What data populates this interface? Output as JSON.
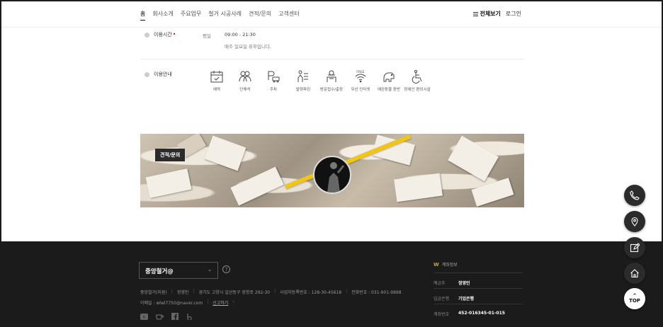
{
  "nav": {
    "items": [
      "홈",
      "회사소개",
      "주요업무",
      "철거 시공사례",
      "견적/문의",
      "고객센터"
    ],
    "all_label": "전체보기",
    "login_label": "로그인"
  },
  "hours": {
    "label": "이용시간",
    "required_mark": "•",
    "day": "평일",
    "time": "09:00 - 21:30",
    "note": "매주 일요일 휴무입니다."
  },
  "amenities": {
    "label": "이용안내",
    "items": [
      {
        "label": "예약",
        "icon": "calendar-icon"
      },
      {
        "label": "단체석",
        "icon": "group-icon"
      },
      {
        "label": "주차",
        "icon": "parking-icon"
      },
      {
        "label": "발렛파킹",
        "icon": "valet-icon"
      },
      {
        "label": "방문접수/출장",
        "icon": "visit-icon"
      },
      {
        "label": "무선 인터넷",
        "icon": "wifi-icon",
        "icon_text": "FREE"
      },
      {
        "label": "애완동물 동반",
        "icon": "pet-icon"
      },
      {
        "label": "장애인 편의시설",
        "icon": "wheelchair-icon"
      }
    ]
  },
  "banner": {
    "badge": "견적/문의"
  },
  "fabs": {
    "phone": "phone-icon",
    "location": "map-pin-icon",
    "write": "edit-icon",
    "home": "home-icon",
    "top_label": "TOP"
  },
  "footer": {
    "company_select": "중앙철거@",
    "help_mark": "?",
    "info_line1": [
      "중앙철거(지원)",
      "정영민",
      "경기도 고양시 일산동구 장항로 292-30",
      "사업자등록번호 : 128-30-45618",
      "전화번호 : 031-901-9898"
    ],
    "email": "이메일 : wlwl7750@naver.com",
    "report_link": "신고하기",
    "social_icons": [
      "blog-icon",
      "cafe-icon",
      "facebook-icon",
      "band-icon"
    ],
    "account": {
      "title": "계좌정보",
      "rows": [
        {
          "key": "예금주",
          "value": "정영민"
        },
        {
          "key": "입금은행",
          "value": "기업은행"
        },
        {
          "key": "계좌번호",
          "value": "452-016345-01-015"
        }
      ]
    }
  },
  "colors": {
    "accent_red": "#e60012",
    "footer_bg": "#1b1b1b",
    "gold": "#c9a34a"
  }
}
